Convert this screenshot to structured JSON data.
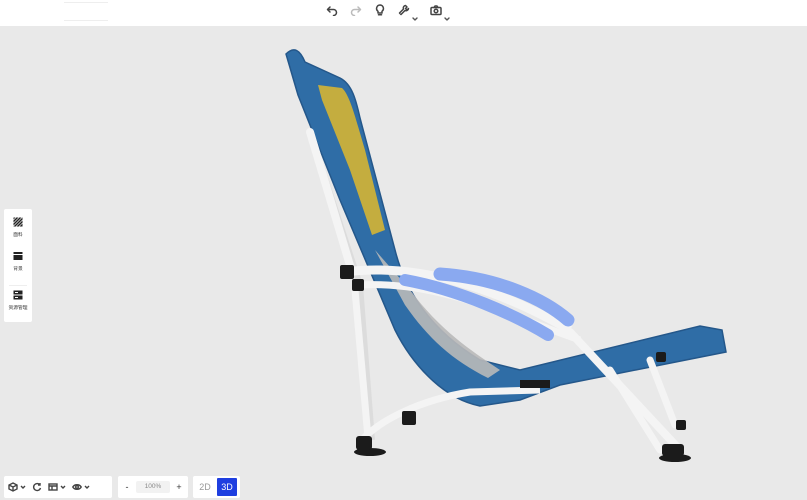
{
  "toolbar": {
    "undo": "undo-icon",
    "redo": "redo-icon",
    "hint": "lightbulb-icon",
    "tools": "wrench-icon",
    "camera": "camera-icon"
  },
  "sidebar": {
    "items": [
      {
        "label": "面料",
        "icon": "fabric-icon"
      },
      {
        "label": "背景",
        "icon": "background-icon"
      },
      {
        "label": "资源管理",
        "icon": "resource-icon"
      }
    ]
  },
  "bottom": {
    "zoom": "100%",
    "zoom_minus": "-",
    "zoom_plus": "+",
    "mode_2d": "2D",
    "mode_3d": "3D",
    "active_mode": "3D"
  },
  "colors": {
    "accent": "#1f3fe0",
    "fabric_blue": "#2b6aa0",
    "fabric_yellow": "#c1aa3f",
    "arm_pad": "#8aa9f0",
    "frame_white": "#f4f4f4",
    "feet_black": "#1b1b1b"
  }
}
